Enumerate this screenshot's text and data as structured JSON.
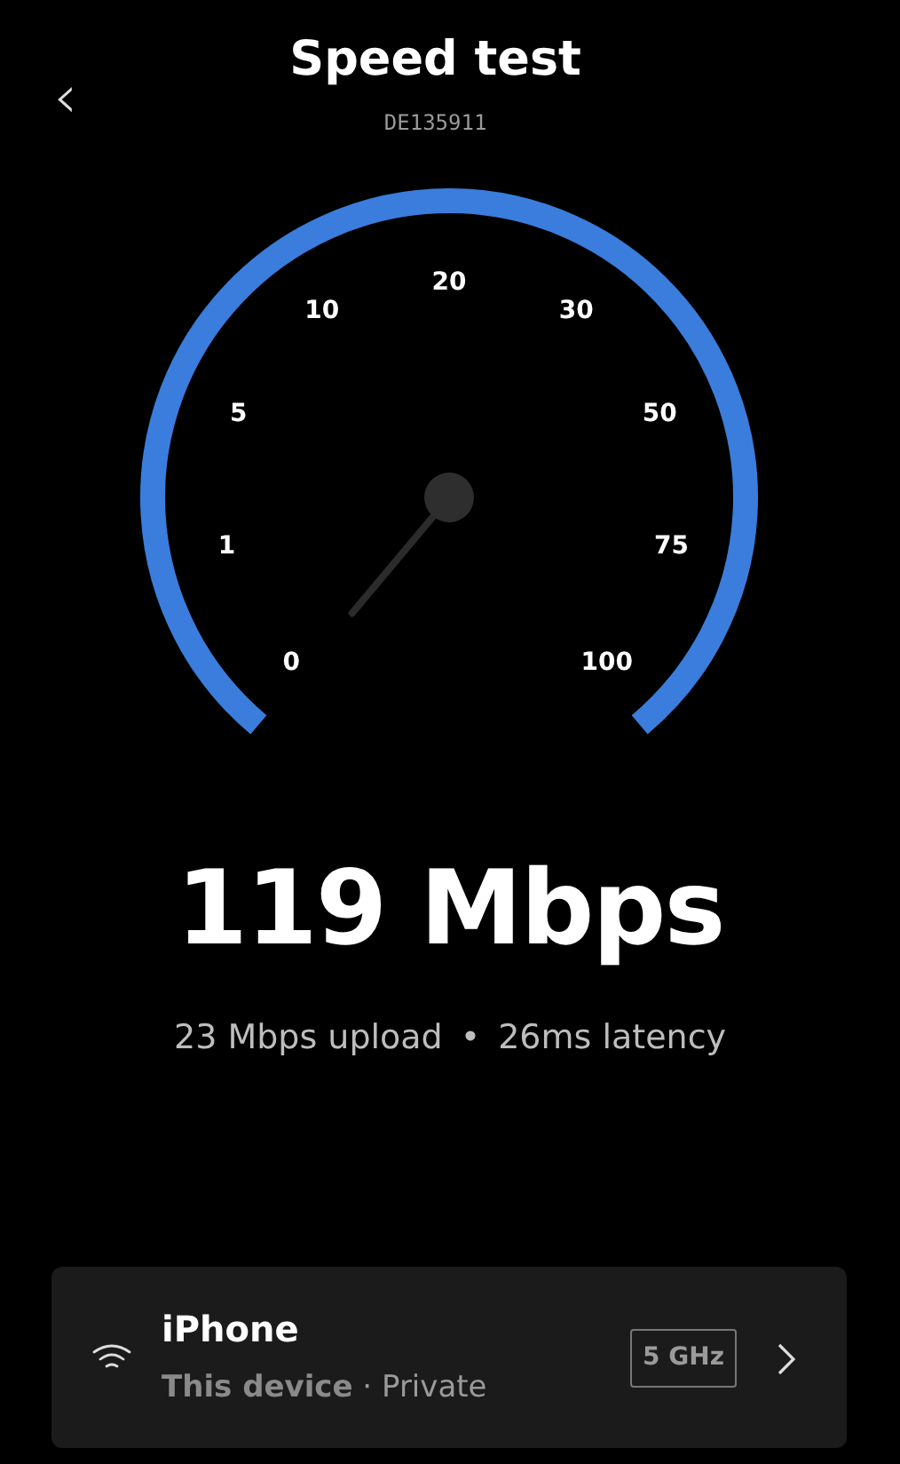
{
  "header": {
    "back": "‹",
    "title": "Speed test",
    "subtitle": "DE135911"
  },
  "gauge": {
    "labels": [
      "0",
      "1",
      "5",
      "10",
      "20",
      "30",
      "50",
      "75",
      "100"
    ]
  },
  "result": {
    "download": "119 Mbps",
    "upload": "23 Mbps upload",
    "separator": "•",
    "latency": "26ms latency"
  },
  "device": {
    "name": "iPhone",
    "detail": "**This device** · Private",
    "band": "5 GHz"
  }
}
